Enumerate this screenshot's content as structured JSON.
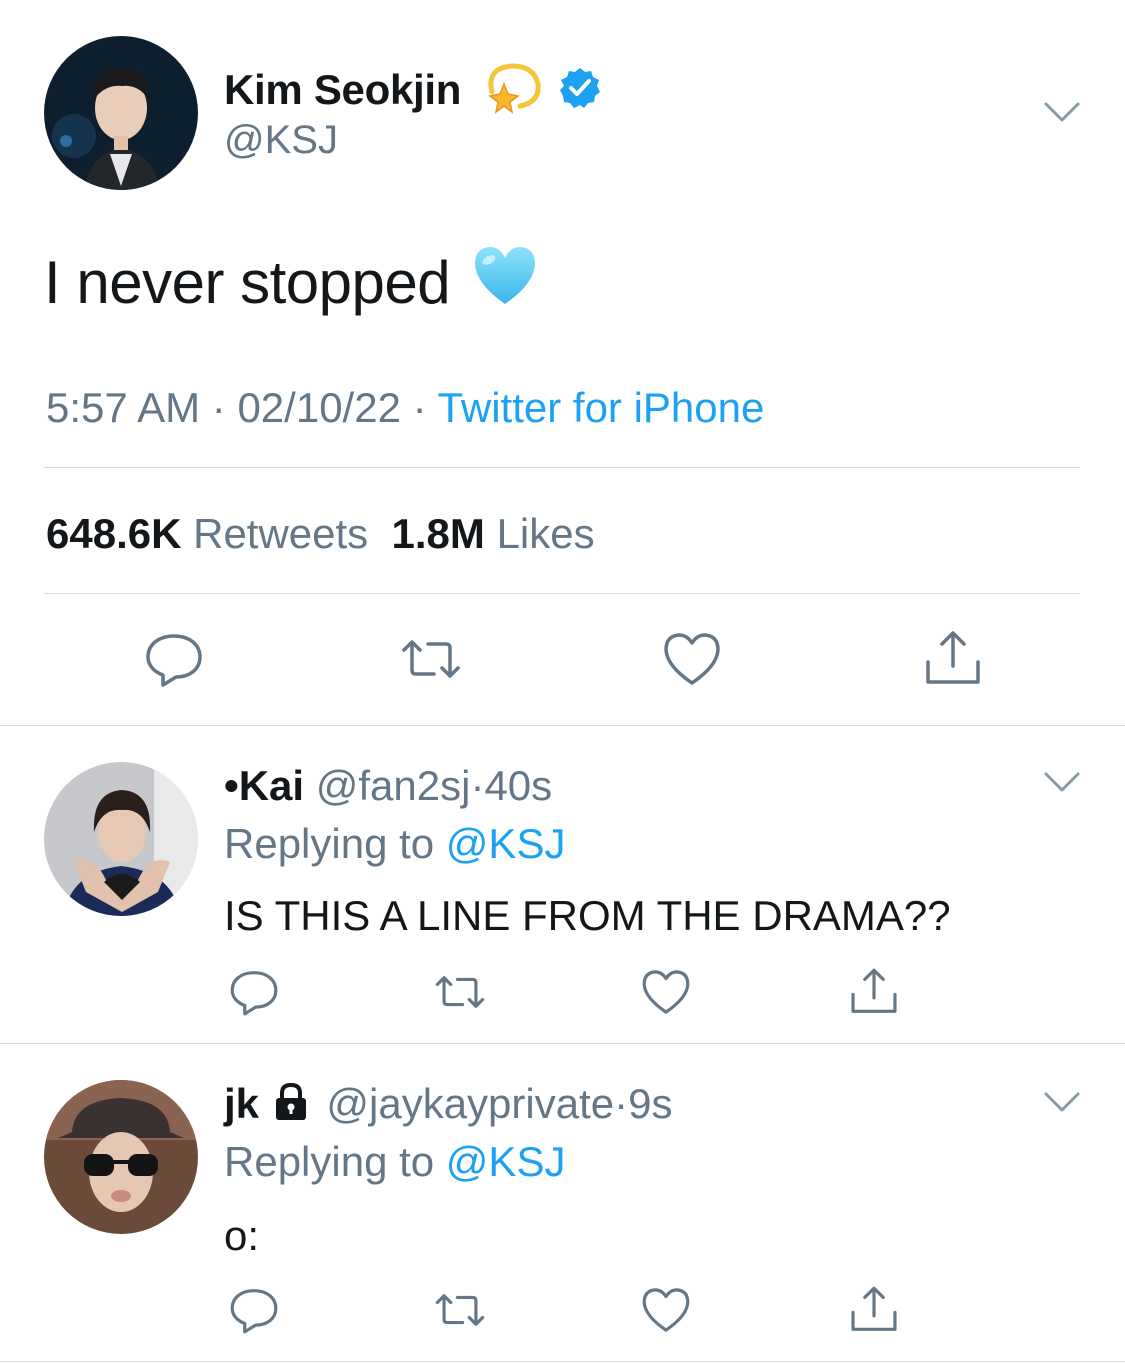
{
  "tweet": {
    "display_name": "Kim Seokjin",
    "name_emoji": "dizzy-star-emoji",
    "verified": true,
    "handle": "@KSJ",
    "text": "I never stopped",
    "text_emoji": "light-blue-heart-emoji",
    "time": "5:57 AM",
    "date": "02/10/22",
    "source": "Twitter for iPhone",
    "retweets_count": "648.6K",
    "retweets_label": "Retweets",
    "likes_count": "1.8M",
    "likes_label": "Likes"
  },
  "replies": [
    {
      "display_name": "•Kai",
      "handle": "@fan2sj",
      "age": "40s",
      "replying_to_label": "Replying to",
      "replying_to": "@KSJ",
      "text": "IS THIS A LINE FROM THE DRAMA??",
      "locked": false
    },
    {
      "display_name": "jk",
      "handle": "@jaykayprivate",
      "age": "9s",
      "replying_to_label": "Replying to",
      "replying_to": "@KSJ",
      "text": "o:",
      "locked": true
    }
  ],
  "separator": "·",
  "colors": {
    "accent": "#1da1f2",
    "secondary_text": "#657786",
    "primary_text": "#14171a",
    "divider": "#d8dee3"
  },
  "icons": {
    "reply": "reply-icon",
    "retweet": "retweet-icon",
    "like": "heart-icon",
    "share": "share-icon",
    "more": "chevron-down-icon",
    "lock": "lock-icon",
    "verified": "verified-badge-icon"
  }
}
